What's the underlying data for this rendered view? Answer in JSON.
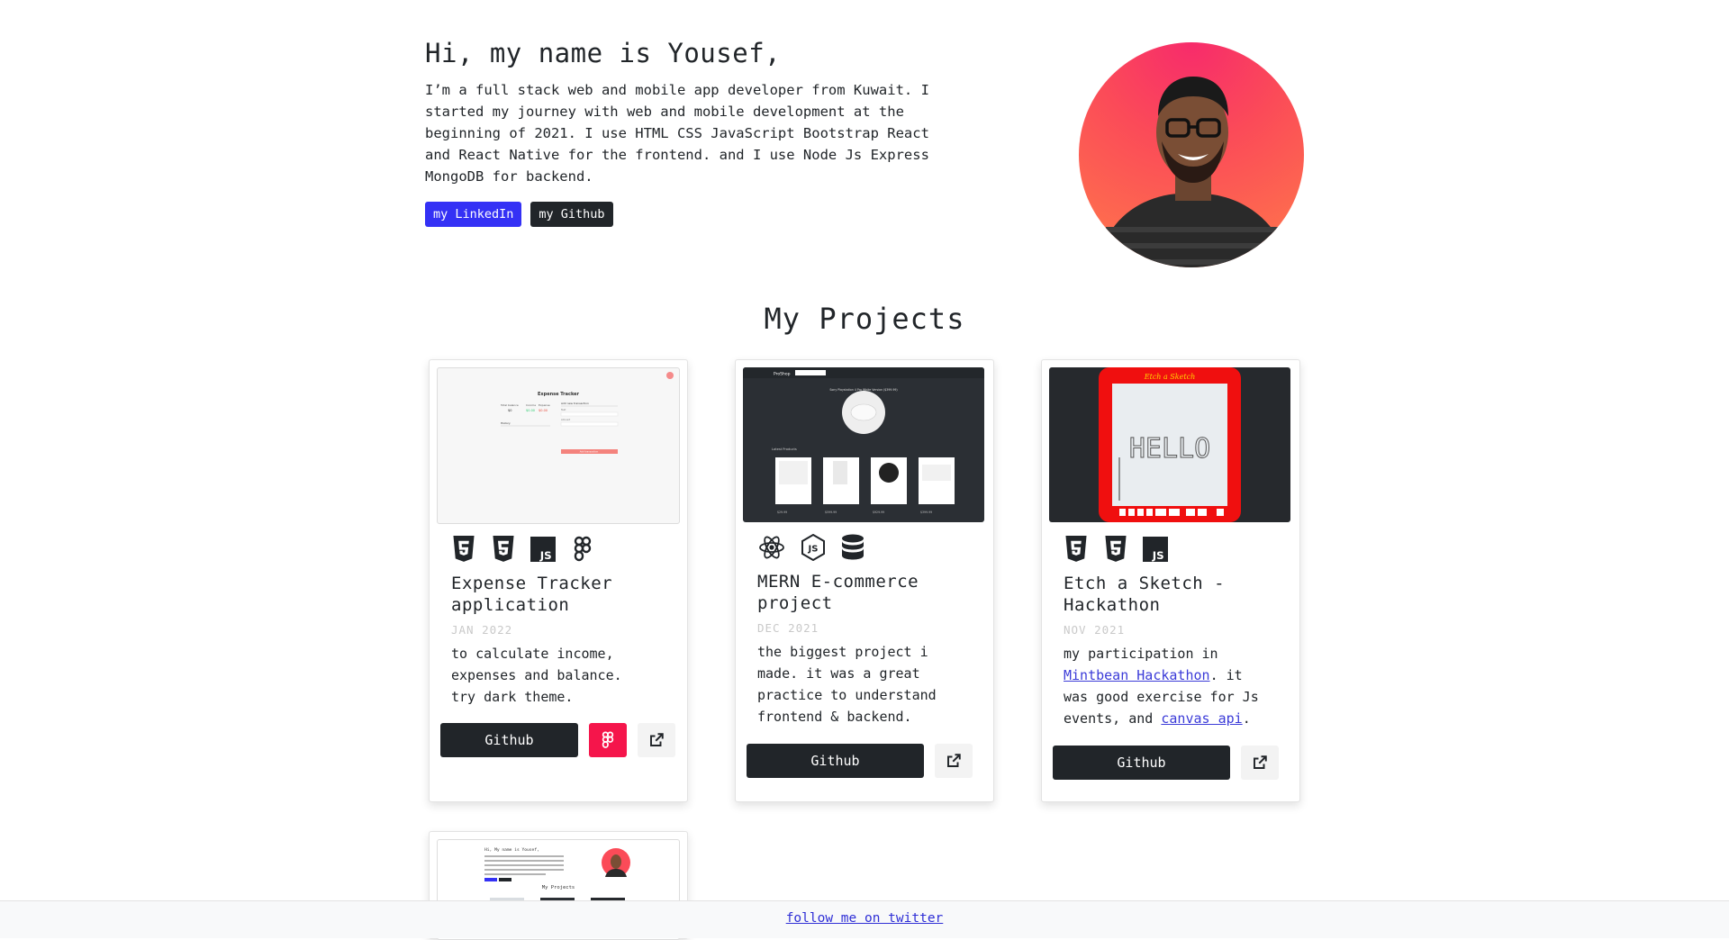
{
  "hero": {
    "title": "Hi, my name is Yousef,",
    "bio": "I’m a full stack web and mobile app developer from Kuwait. I started my journey with web and mobile development at the beginning of 2021. I use HTML CSS JavaScript Bootstrap React and React Native for the frontend. and I use Node Js Express MongoDB for backend.",
    "linkedin_label": "my LinkedIn",
    "github_label": "my Github"
  },
  "projects_title": "My Projects",
  "projects": [
    {
      "title": "Expense Tracker application",
      "date": "JAN 2022",
      "description": "to calculate income, expenses and balance. try dark theme.",
      "github_label": "Github",
      "icons": [
        "html5-icon",
        "css3-icon",
        "javascript-icon",
        "figma-icon"
      ],
      "thumb": {
        "heading": "Expense Tracker",
        "labels": [
          "Total balance",
          "Income",
          "Expense",
          "History",
          "Add new transaction",
          "Text",
          "Amount",
          "Add transaction"
        ],
        "values": [
          "$0",
          "$0.00",
          "$0.00"
        ]
      }
    },
    {
      "title": "MERN E-commerce project",
      "date": "DEC 2021",
      "description": "the biggest project i made. it was a great practice to understand frontend & backend.",
      "github_label": "Github",
      "icons": [
        "react-icon",
        "nodejs-icon",
        "database-icon"
      ],
      "thumb": {
        "brand": "ProShop",
        "hero_text": "Sony Playstation 4 Pro White Version ($399.99)",
        "latest_label": "Latest Products",
        "prices": [
          "$29.99",
          "$599.99",
          "$929.99",
          "$399.99"
        ]
      }
    },
    {
      "title": "Etch a Sketch - Hackathon",
      "date": "NOV 2021",
      "description_before": "my participation in ",
      "link1": "Mintbean Hackathon",
      "description_mid": ". it was good exercise for Js events, and ",
      "link2": "canvas api",
      "description_after": ".",
      "github_label": "Github",
      "icons": [
        "html5-icon",
        "css3-icon",
        "javascript-icon"
      ],
      "thumb": {
        "heading": "Etch a Sketch",
        "drawing": "HELLO"
      }
    },
    {
      "thumb": {
        "heading": "Hi, My name is Yousef,",
        "section": "My Projects"
      }
    }
  ],
  "footer": {
    "link": "follow me on twitter"
  },
  "colors": {
    "primary_button": "#3431f5",
    "dark": "#212529",
    "figma_red": "#f5154b",
    "link": "#2f2fd6"
  }
}
